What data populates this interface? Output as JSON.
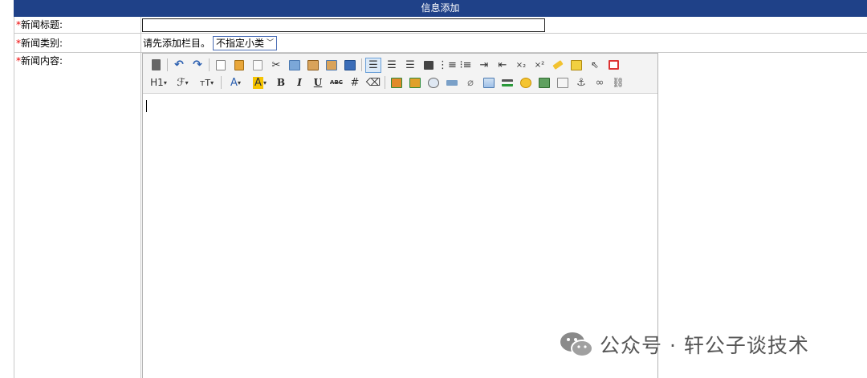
{
  "header": {
    "title": "信息添加"
  },
  "form": {
    "required_mark": "*",
    "title_label": "新闻标题:",
    "title_value": "",
    "category_label": "新闻类别:",
    "category_prefix": "请先添加栏目。",
    "category_select_value": "不指定小类",
    "content_label": "新闻内容:"
  },
  "editor": {
    "toolbar_row1": [
      "source-icon",
      "undo-icon",
      "redo-icon",
      "preview-icon",
      "template-icon",
      "new-doc-icon",
      "cut-icon",
      "copy-icon",
      "paste-icon",
      "paste-text-icon",
      "paste-word-icon",
      "align-left-icon",
      "align-center-icon",
      "align-right-icon",
      "justify-icon",
      "ordered-list-icon",
      "unordered-list-icon",
      "indent-icon",
      "outdent-icon",
      "subscript-icon",
      "superscript-icon",
      "clear-format-icon",
      "select-all-icon",
      "pointer-icon",
      "fullscreen-icon"
    ],
    "toolbar_row2": {
      "heading": "H1",
      "font_family": "ℱ",
      "font_size": "тT",
      "forecolor": "A",
      "hilitecolor": "A",
      "bold": "B",
      "italic": "I",
      "underline": "U",
      "strikethrough": "ABC",
      "dropdown_arrow": "▾"
    },
    "content": ""
  },
  "watermark": {
    "text": "公众号 · 轩公子谈技术"
  },
  "colors": {
    "header_bg": "#1f4188",
    "required": "#e00000",
    "select_border": "#4a6db5"
  }
}
